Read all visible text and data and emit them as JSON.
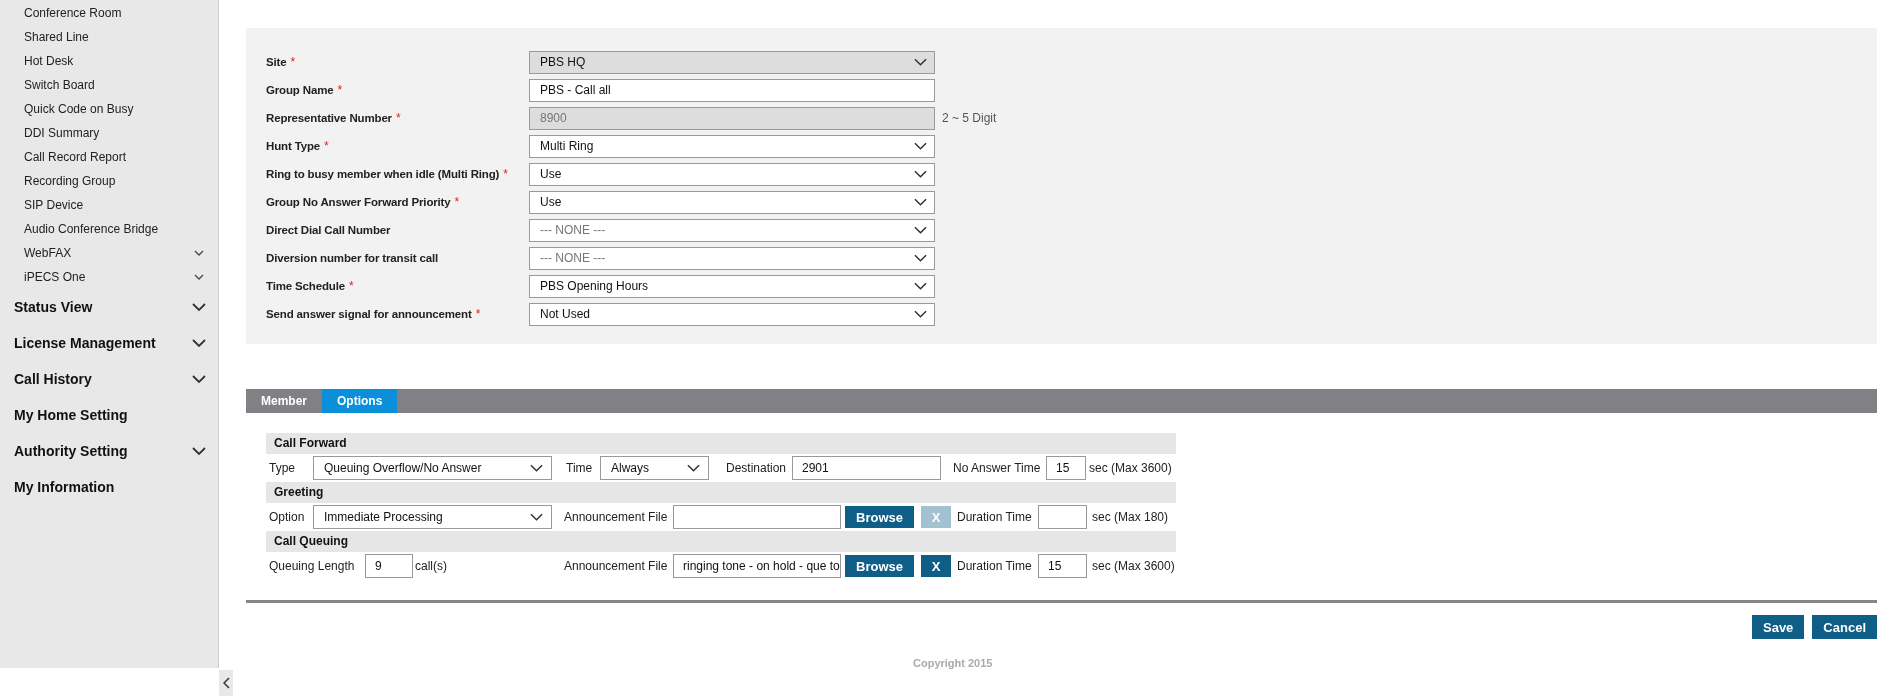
{
  "sidebar": {
    "sub_items": [
      {
        "label": "Conference Room",
        "expandable": false
      },
      {
        "label": "Shared Line",
        "expandable": false
      },
      {
        "label": "Hot Desk",
        "expandable": false
      },
      {
        "label": "Switch Board",
        "expandable": false
      },
      {
        "label": "Quick Code on Busy",
        "expandable": false
      },
      {
        "label": "DDI Summary",
        "expandable": false
      },
      {
        "label": "Call Record Report",
        "expandable": false
      },
      {
        "label": "Recording Group",
        "expandable": false
      },
      {
        "label": "SIP Device",
        "expandable": false
      },
      {
        "label": "Audio Conference Bridge",
        "expandable": false
      },
      {
        "label": "WebFAX",
        "expandable": true
      },
      {
        "label": "iPECS One",
        "expandable": true
      }
    ],
    "items": [
      {
        "label": "Status View",
        "expandable": true
      },
      {
        "label": "License Management",
        "expandable": true
      },
      {
        "label": "Call History",
        "expandable": true
      },
      {
        "label": "My Home Setting",
        "expandable": false
      },
      {
        "label": "Authority Setting",
        "expandable": true
      },
      {
        "label": "My Information",
        "expandable": false
      }
    ]
  },
  "form": [
    {
      "label": "Site",
      "required_mark": "*",
      "kind": "select",
      "value": "PBS HQ",
      "disabled": true
    },
    {
      "label": "Group Name",
      "required_mark": "*",
      "kind": "text",
      "value": "PBS - Call all",
      "disabled": false
    },
    {
      "label": "Representative Number",
      "required_mark": "*",
      "kind": "text",
      "value": "8900",
      "disabled": true,
      "hint": "2 ~ 5 Digit"
    },
    {
      "label": "Hunt Type",
      "required_mark": "*",
      "kind": "select",
      "value": "Multi Ring",
      "disabled": false
    },
    {
      "label": "Ring to busy member when idle (Multi Ring)",
      "required_mark": "*",
      "kind": "select",
      "value": "Use",
      "disabled": false
    },
    {
      "label": "Group No Answer Forward Priority",
      "required_mark": "*",
      "kind": "select",
      "value": "Use",
      "disabled": false
    },
    {
      "label": "Direct Dial Call Number",
      "kind": "select",
      "value": "--- NONE ---",
      "disabled": false,
      "empty": true
    },
    {
      "label": "Diversion number for transit call",
      "kind": "select",
      "value": "--- NONE ---",
      "disabled": false,
      "empty": true
    },
    {
      "label": "Time Schedule",
      "required_mark": "*",
      "kind": "select",
      "value": "PBS Opening Hours",
      "disabled": false
    },
    {
      "label": "Send answer signal for announcement",
      "required_mark": "*",
      "kind": "select",
      "value": "Not Used",
      "disabled": false
    }
  ],
  "tabs": [
    {
      "label": "Member",
      "selected": false
    },
    {
      "label": "Options",
      "selected": true
    }
  ],
  "options": [
    {
      "title": "Call Forward",
      "fields": [
        {
          "kind": "label",
          "text": "Type"
        },
        {
          "kind": "select",
          "value": "Queuing Overflow/No Answer"
        },
        {
          "kind": "label",
          "text": "Time"
        },
        {
          "kind": "select",
          "value": "Always"
        },
        {
          "kind": "label",
          "text": "Destination"
        },
        {
          "kind": "input",
          "value": "2901"
        },
        {
          "kind": "label",
          "text": "No Answer Time"
        },
        {
          "kind": "input",
          "value": "15"
        },
        {
          "kind": "label",
          "text": "sec (Max 3600)"
        }
      ]
    },
    {
      "title": "Greeting",
      "fields": [
        {
          "kind": "label",
          "text": "Option"
        },
        {
          "kind": "select",
          "value": "Immediate Processing"
        },
        {
          "kind": "label",
          "text": "Announcement File"
        },
        {
          "kind": "input"
        },
        {
          "kind": "browse_button",
          "text": "Browse",
          "disabled": false
        },
        {
          "kind": "clear_button",
          "text": "X",
          "disabled": true
        },
        {
          "kind": "label",
          "text": "Duration Time"
        },
        {
          "kind": "input"
        },
        {
          "kind": "label",
          "text": "sec (Max 180)"
        }
      ]
    },
    {
      "title": "Call Queuing",
      "fields": [
        {
          "kind": "label",
          "text": "Queuing Length"
        },
        {
          "kind": "input",
          "value": "9"
        },
        {
          "kind": "label",
          "text": "call(s)"
        },
        {
          "kind": "label",
          "text": "Announcement File"
        },
        {
          "kind": "input",
          "value": "ringing tone - on hold - que to"
        },
        {
          "kind": "browse_button",
          "text": "Browse",
          "disabled": false
        },
        {
          "kind": "clear_button",
          "text": "X",
          "disabled": false
        },
        {
          "kind": "label",
          "text": "Duration Time"
        },
        {
          "kind": "input",
          "value": "15"
        },
        {
          "kind": "label",
          "text": "sec (Max 3600)"
        }
      ]
    }
  ],
  "buttons": [
    {
      "label": "Save"
    },
    {
      "label": "Cancel"
    }
  ],
  "footer": "Copyright 2015"
}
